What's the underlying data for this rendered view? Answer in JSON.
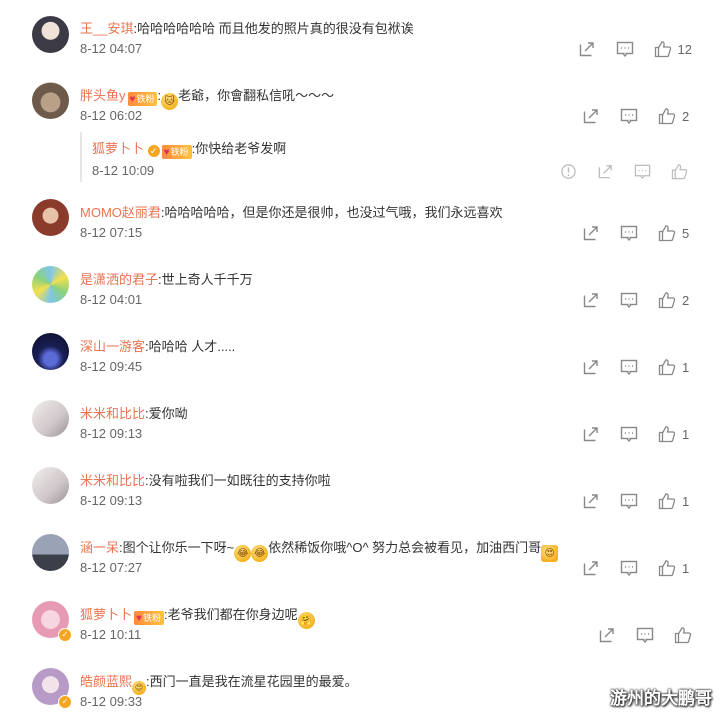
{
  "comments": [
    {
      "user": "王__安琪",
      "text": ":哈哈哈哈哈哈 而且他发的照片真的很没有包袱诶",
      "time": "8-12 04:07",
      "likes": "12"
    },
    {
      "user": "胖头鱼y",
      "badge": "铁粉",
      "text": "老爺，你會翻私信吼～～～",
      "time": "8-12 06:02",
      "likes": "2"
    },
    {
      "user": "狐萝卜卜",
      "badge": "铁粉",
      "text": ":你快给老爷发啊",
      "time": "8-12 10:09",
      "likes": ""
    },
    {
      "user": "MOMO赵丽君",
      "text": ":哈哈哈哈哈，但是你还是很帅，也没过气哦，我们永远喜欢",
      "time": "8-12 07:15",
      "likes": "5"
    },
    {
      "user": "是潇洒的君子",
      "text": ":世上奇人千千万",
      "time": "8-12 04:01",
      "likes": "2"
    },
    {
      "user": "深山一游客",
      "text": ":哈哈哈 人才.....",
      "time": "8-12 09:45",
      "likes": "1"
    },
    {
      "user": "米米和比比",
      "text": ":爱你呦",
      "time": "8-12 09:13",
      "likes": "1"
    },
    {
      "user": "米米和比比",
      "text": ":没有啦我们一如既往的支持你啦",
      "time": "8-12 09:13",
      "likes": "1"
    },
    {
      "user": "涵一呆",
      "text_a": ":图个让你乐一下呀~",
      "text_b": "依然稀饭你哦^O^ 努力总会被看见，加油西门哥",
      "time": "8-12 07:27",
      "likes": "1"
    },
    {
      "user": "狐萝卜卜",
      "badge": "铁粉",
      "text": ":老爷我们都在你身边呢",
      "time": "8-12 10:11",
      "likes": ""
    },
    {
      "user": "皓颜蓝熙",
      "text": ":西门一直是我在流星花园里的最爱。",
      "time": "8-12 09:33",
      "likes": ""
    }
  ],
  "icons": {
    "share": "share-icon",
    "comment": "comment-icon",
    "like": "thumbs-up-icon",
    "report": "report-icon"
  },
  "watermark": "游州的大鹏哥",
  "colors": {
    "username": "#eb7350",
    "text": "#333333",
    "meta": "#666666",
    "icon": "#888888"
  }
}
